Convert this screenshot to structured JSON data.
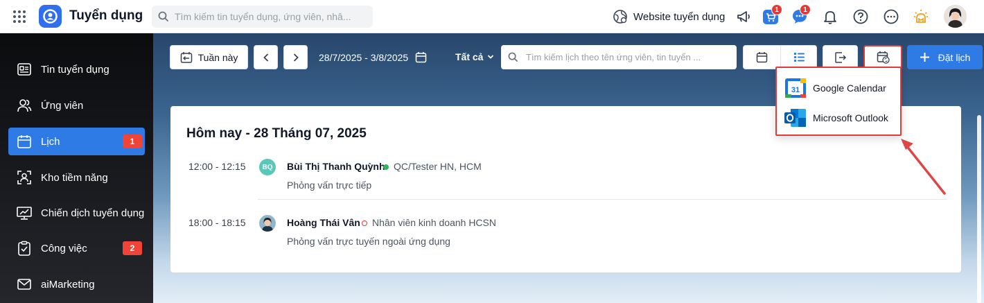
{
  "header": {
    "app_title": "Tuyển dụng",
    "search_placeholder": "Tìm kiếm tin tuyển dụng, ứng viên, nhâ...",
    "website_link": "Website tuyển dụng",
    "cart_badge": "1",
    "chat_badge": "1"
  },
  "sidebar": {
    "items": [
      {
        "label": "Tin tuyển dụng",
        "icon": "job-post-icon"
      },
      {
        "label": "Ứng viên",
        "icon": "candidates-icon"
      },
      {
        "label": "Lịch",
        "icon": "calendar-icon",
        "badge": "1",
        "active": true
      },
      {
        "label": "Kho tiềm năng",
        "icon": "talent-pool-icon"
      },
      {
        "label": "Chiến dịch tuyển dụng",
        "icon": "campaign-icon"
      },
      {
        "label": "Công việc",
        "icon": "task-icon",
        "badge": "2"
      },
      {
        "label": "aiMarketing",
        "icon": "mail-icon"
      }
    ]
  },
  "toolbar": {
    "week_label": "Tuần này",
    "date_range": "28/7/2025 - 3/8/2025",
    "filter_label": "Tất cả",
    "search_placeholder": "Tìm kiếm lịch theo tên ứng viên, tin tuyển ...",
    "book_label": "Đặt lịch"
  },
  "calendar": {
    "heading": "Hôm nay - 28 Tháng 07, 2025",
    "events": [
      {
        "time": "12:00 - 12:15",
        "initials": "BQ",
        "name": "Bùi Thị Thanh Quỳnh",
        "job": "QC/Tester HN, HCM",
        "status_color": "#2eb85c",
        "type": "Phỏng vấn trực tiếp"
      },
      {
        "time": "18:00 - 18:15",
        "name": "Hoàng Thái Vân",
        "job": "Nhân viên kinh doanh HCSN",
        "status_color": "#e53935",
        "type": "Phỏng vấn trực tuyến ngoài ứng dụng"
      }
    ]
  },
  "sync_menu": {
    "items": [
      {
        "label": "Google Calendar",
        "icon": "google-calendar-icon"
      },
      {
        "label": "Microsoft Outlook",
        "icon": "outlook-icon"
      }
    ]
  },
  "colors": {
    "accent": "#2f7be5",
    "highlight": "#e03a3a",
    "badge": "#f04438"
  }
}
